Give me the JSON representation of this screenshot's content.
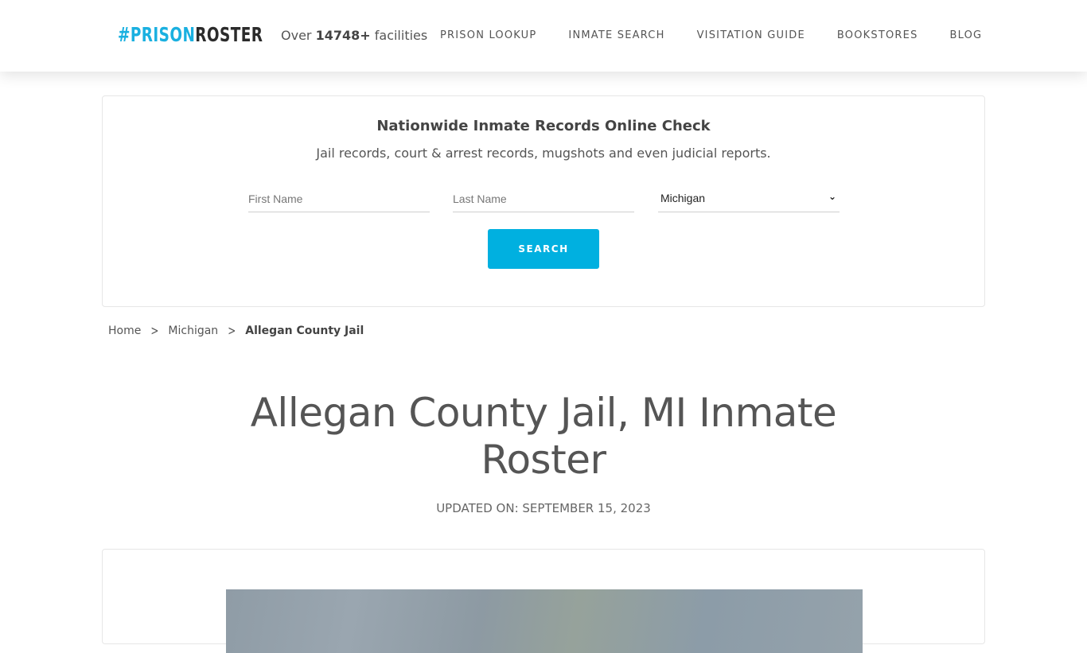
{
  "header": {
    "logo": {
      "hash": "#",
      "part1": "PRISON",
      "part2": "ROSTER"
    },
    "tagline": {
      "prefix": "Over",
      "count": "14748+",
      "suffix": "facilities"
    },
    "nav": [
      {
        "label": "PRISON LOOKUP"
      },
      {
        "label": "INMATE SEARCH"
      },
      {
        "label": "VISITATION GUIDE"
      },
      {
        "label": "BOOKSTORES"
      },
      {
        "label": "BLOG"
      }
    ]
  },
  "search": {
    "title": "Nationwide Inmate Records Online Check",
    "subtitle": "Jail records, court & arrest records, mugshots and even judicial reports.",
    "first_name_placeholder": "First Name",
    "last_name_placeholder": "Last Name",
    "state_selected": "Michigan",
    "button_label": "SEARCH",
    "accent_color": "#00b0e0"
  },
  "breadcrumb": {
    "items": [
      {
        "label": "Home"
      },
      {
        "label": "Michigan"
      }
    ],
    "current": "Allegan County Jail"
  },
  "page": {
    "title": "Allegan County Jail, MI Inmate Roster",
    "updated": "UPDATED ON: SEPTEMBER 15, 2023"
  }
}
